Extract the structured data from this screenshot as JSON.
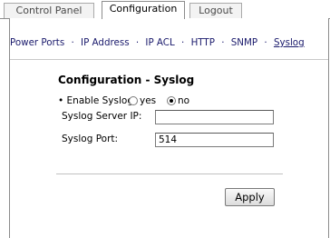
{
  "tabs": [
    {
      "label": "Control Panel"
    },
    {
      "label": "Configuration"
    },
    {
      "label": "Logout"
    }
  ],
  "subnav": {
    "items": [
      "Power Ports",
      "IP Address",
      "IP ACL",
      "HTTP",
      "SNMP",
      "Syslog"
    ],
    "current": "Syslog",
    "separator": "·"
  },
  "form": {
    "title": "Configuration - Syslog",
    "enable_label": "• Enable Syslog",
    "option_yes": "yes",
    "option_no": "no",
    "selected": "no",
    "server_ip_label": "Syslog Server IP:",
    "server_ip_value": "",
    "port_label": "Syslog Port:",
    "port_value": "514",
    "apply_label": "Apply"
  }
}
